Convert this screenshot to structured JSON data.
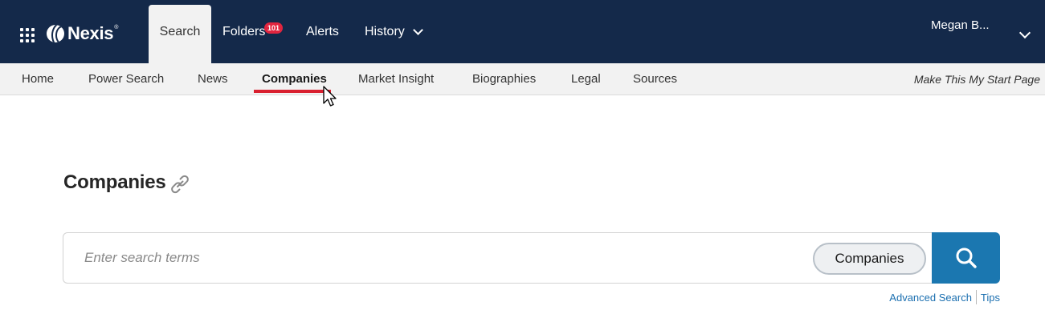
{
  "app": {
    "brand": "Nexis",
    "brand_mark": "®"
  },
  "topnav": {
    "tabs": [
      {
        "label": "Search",
        "active": true
      },
      {
        "label": "Folders",
        "badge": "101"
      },
      {
        "label": "Alerts"
      },
      {
        "label": "History",
        "has_dropdown": true
      }
    ],
    "user": "Megan B..."
  },
  "subnav": {
    "items": [
      {
        "label": "Home"
      },
      {
        "label": "Power Search"
      },
      {
        "label": "News"
      },
      {
        "label": "Companies",
        "active": true
      },
      {
        "label": "Market Insight"
      },
      {
        "label": "Biographies"
      },
      {
        "label": "Legal"
      },
      {
        "label": "Sources"
      }
    ],
    "start_page_label": "Make This My Start Page"
  },
  "main": {
    "title": "Companies",
    "search": {
      "placeholder": "Enter search terms",
      "value": "",
      "scope": "Companies"
    },
    "links": {
      "advanced": "Advanced Search",
      "tips": "Tips"
    }
  },
  "colors": {
    "topbar_bg": "#14294a",
    "accent_red": "#d9202f",
    "badge_red": "#e1253f",
    "search_blue": "#1b77b0",
    "link_blue": "#1b6fb0"
  },
  "icons": [
    "apps-grid-icon",
    "nexis-logo-icon",
    "chevron-down-icon",
    "paperclip-icon",
    "search-icon",
    "mouse-cursor-icon"
  ]
}
